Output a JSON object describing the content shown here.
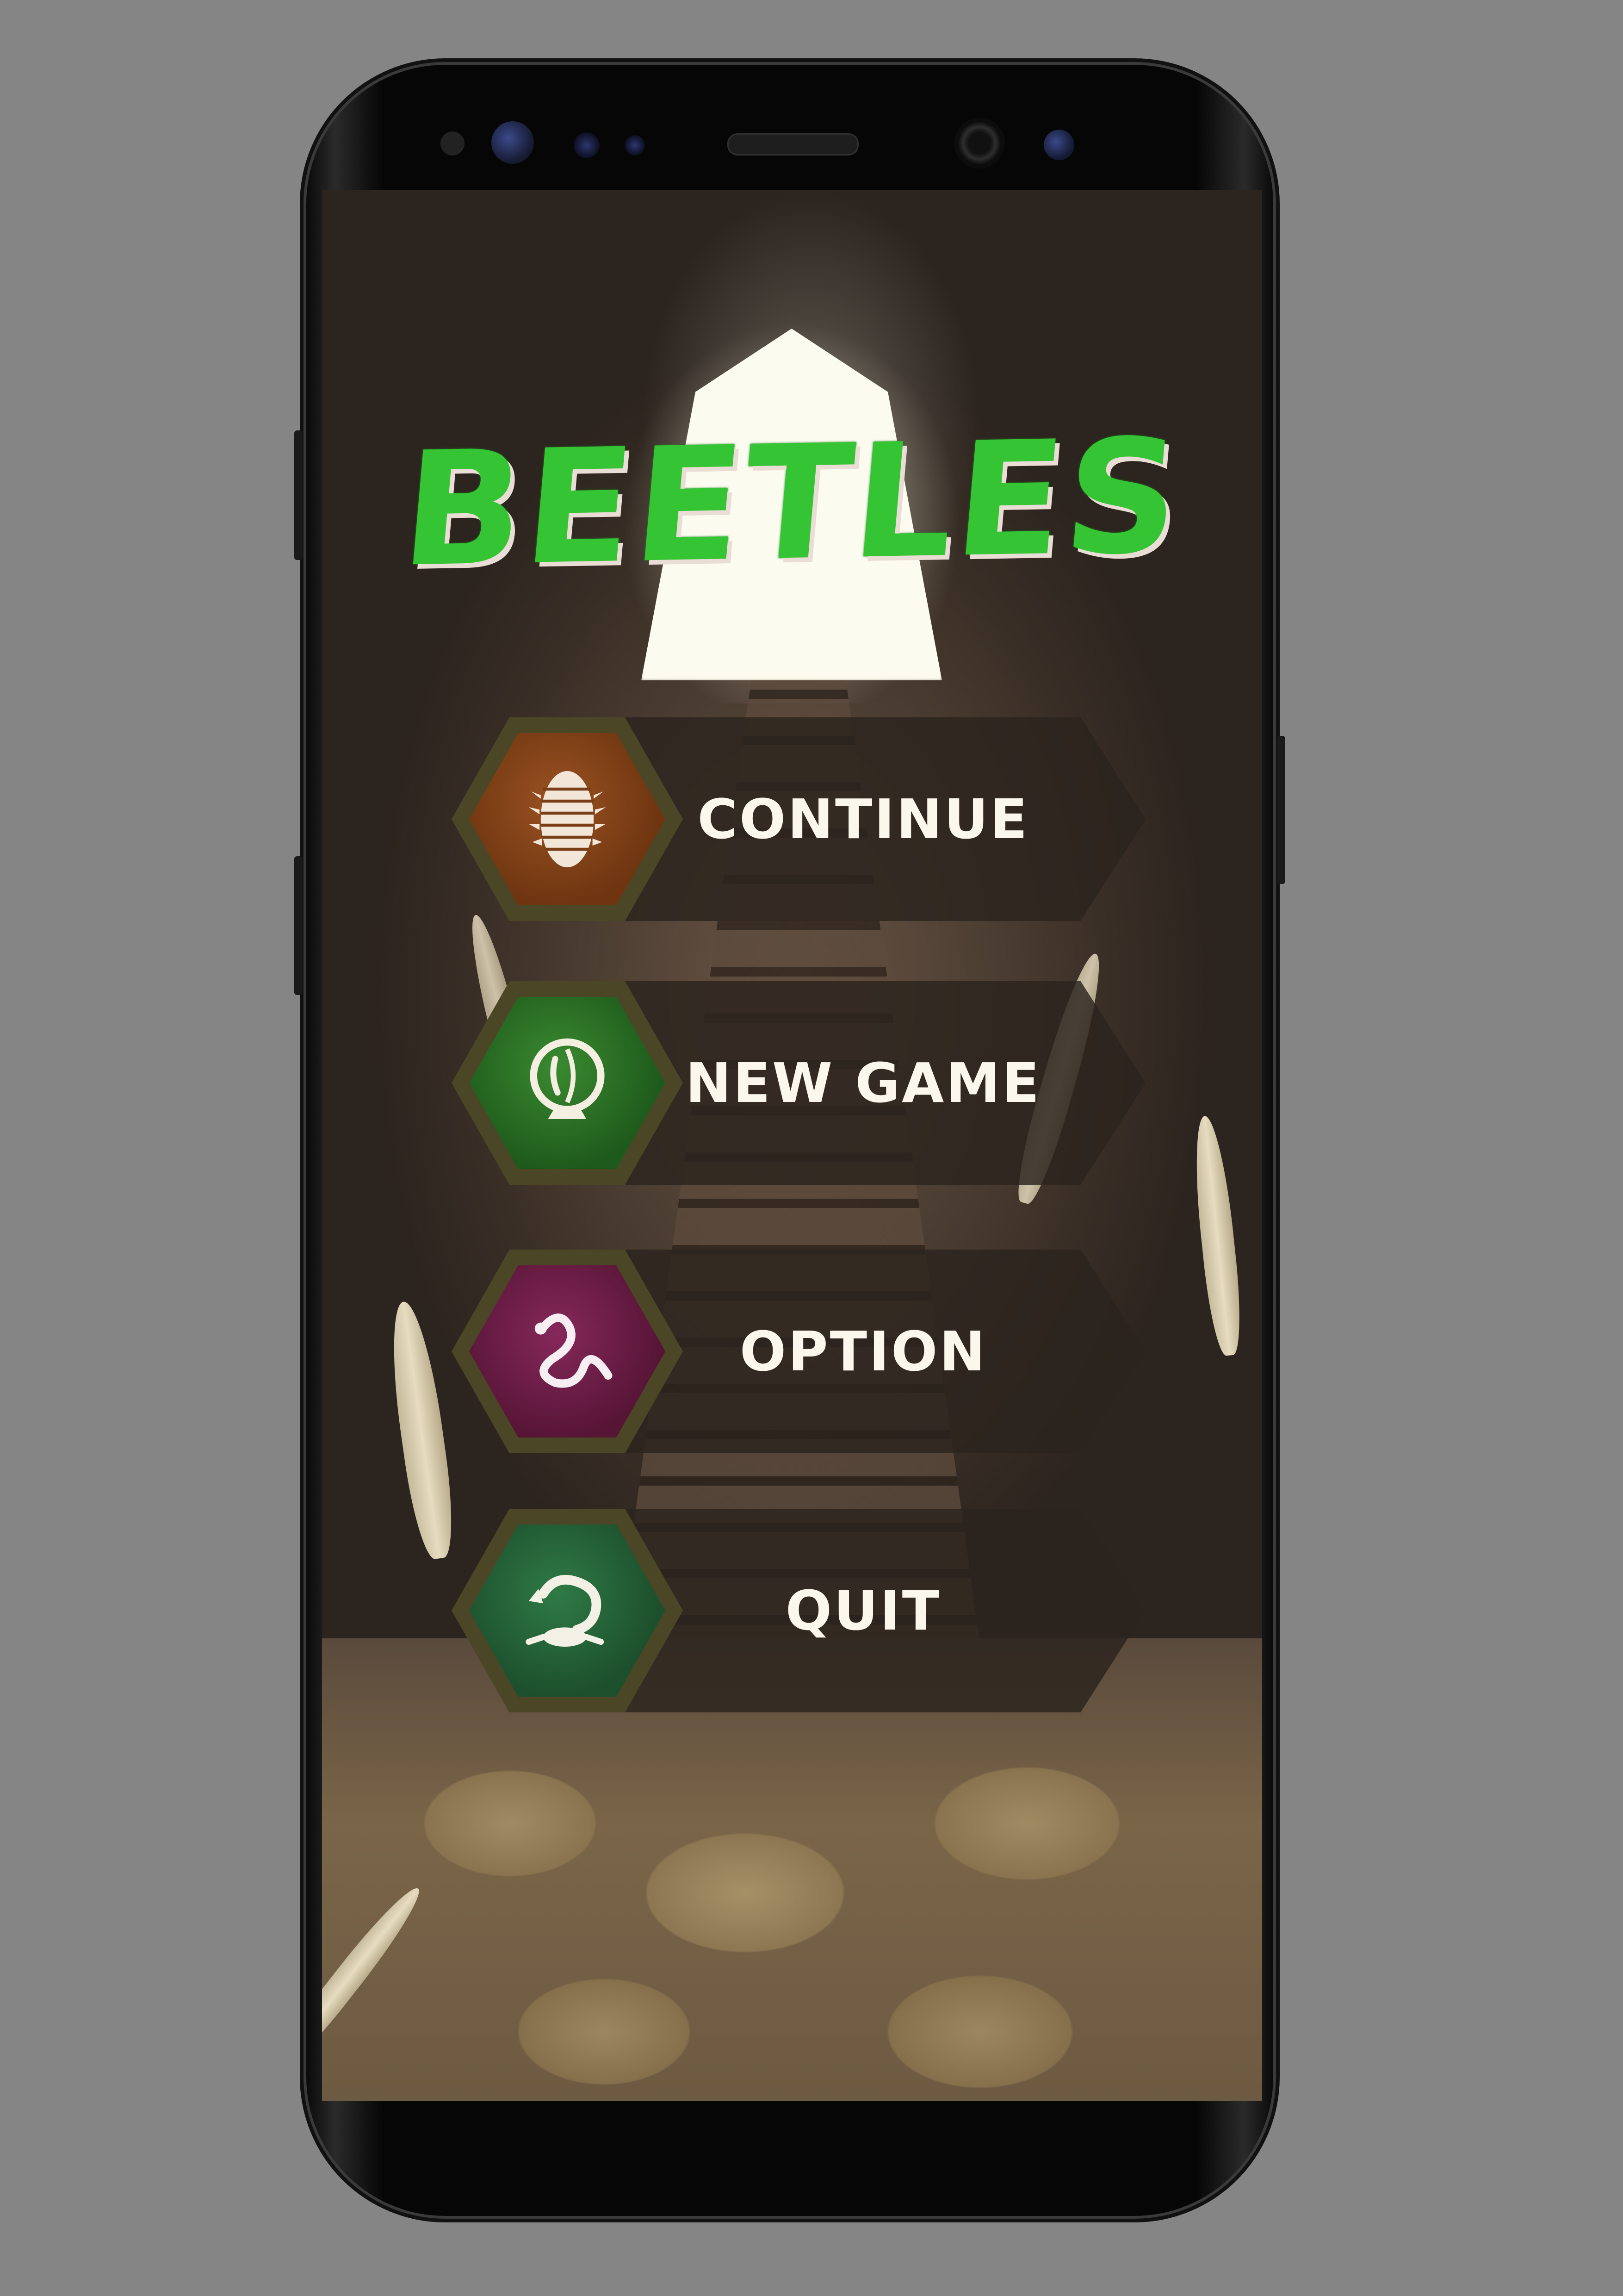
{
  "game": {
    "title": "BEETLES",
    "title_color": "#34c434"
  },
  "menu": [
    {
      "label": "CONTINUE",
      "icon": "beetle-larva-icon",
      "color": "#7a3e16"
    },
    {
      "label": "NEW GAME",
      "icon": "glass-orb-icon",
      "color": "#2a6a26"
    },
    {
      "label": "OPTION",
      "icon": "worm-icon",
      "color": "#6a1c42"
    },
    {
      "label": "QUIT",
      "icon": "scorpion-icon",
      "color": "#25603a"
    }
  ]
}
